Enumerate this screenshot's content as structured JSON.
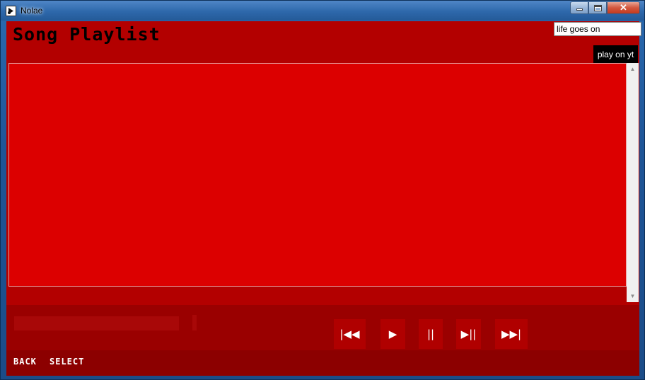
{
  "window": {
    "title": "Nolae"
  },
  "header": {
    "title": "Song Playlist"
  },
  "search": {
    "value": "life goes on"
  },
  "actions": {
    "play_on_yt": "play on yt"
  },
  "player": {
    "prev_label": "|◀◀",
    "play_label": "▶",
    "pause_label": "||",
    "play_pause_label": "▶||",
    "next_label": "▶▶|"
  },
  "footer": {
    "back_label": "BACK",
    "select_label": "SELECT"
  },
  "colors": {
    "background": "#b30000",
    "playlist": "#dc0000",
    "controls": "#9a0000",
    "footer": "#8c0000"
  },
  "icons": {
    "app": "app-logo-icon",
    "minimize": "minimize-icon",
    "maximize": "maximize-icon",
    "close": "close-icon"
  }
}
